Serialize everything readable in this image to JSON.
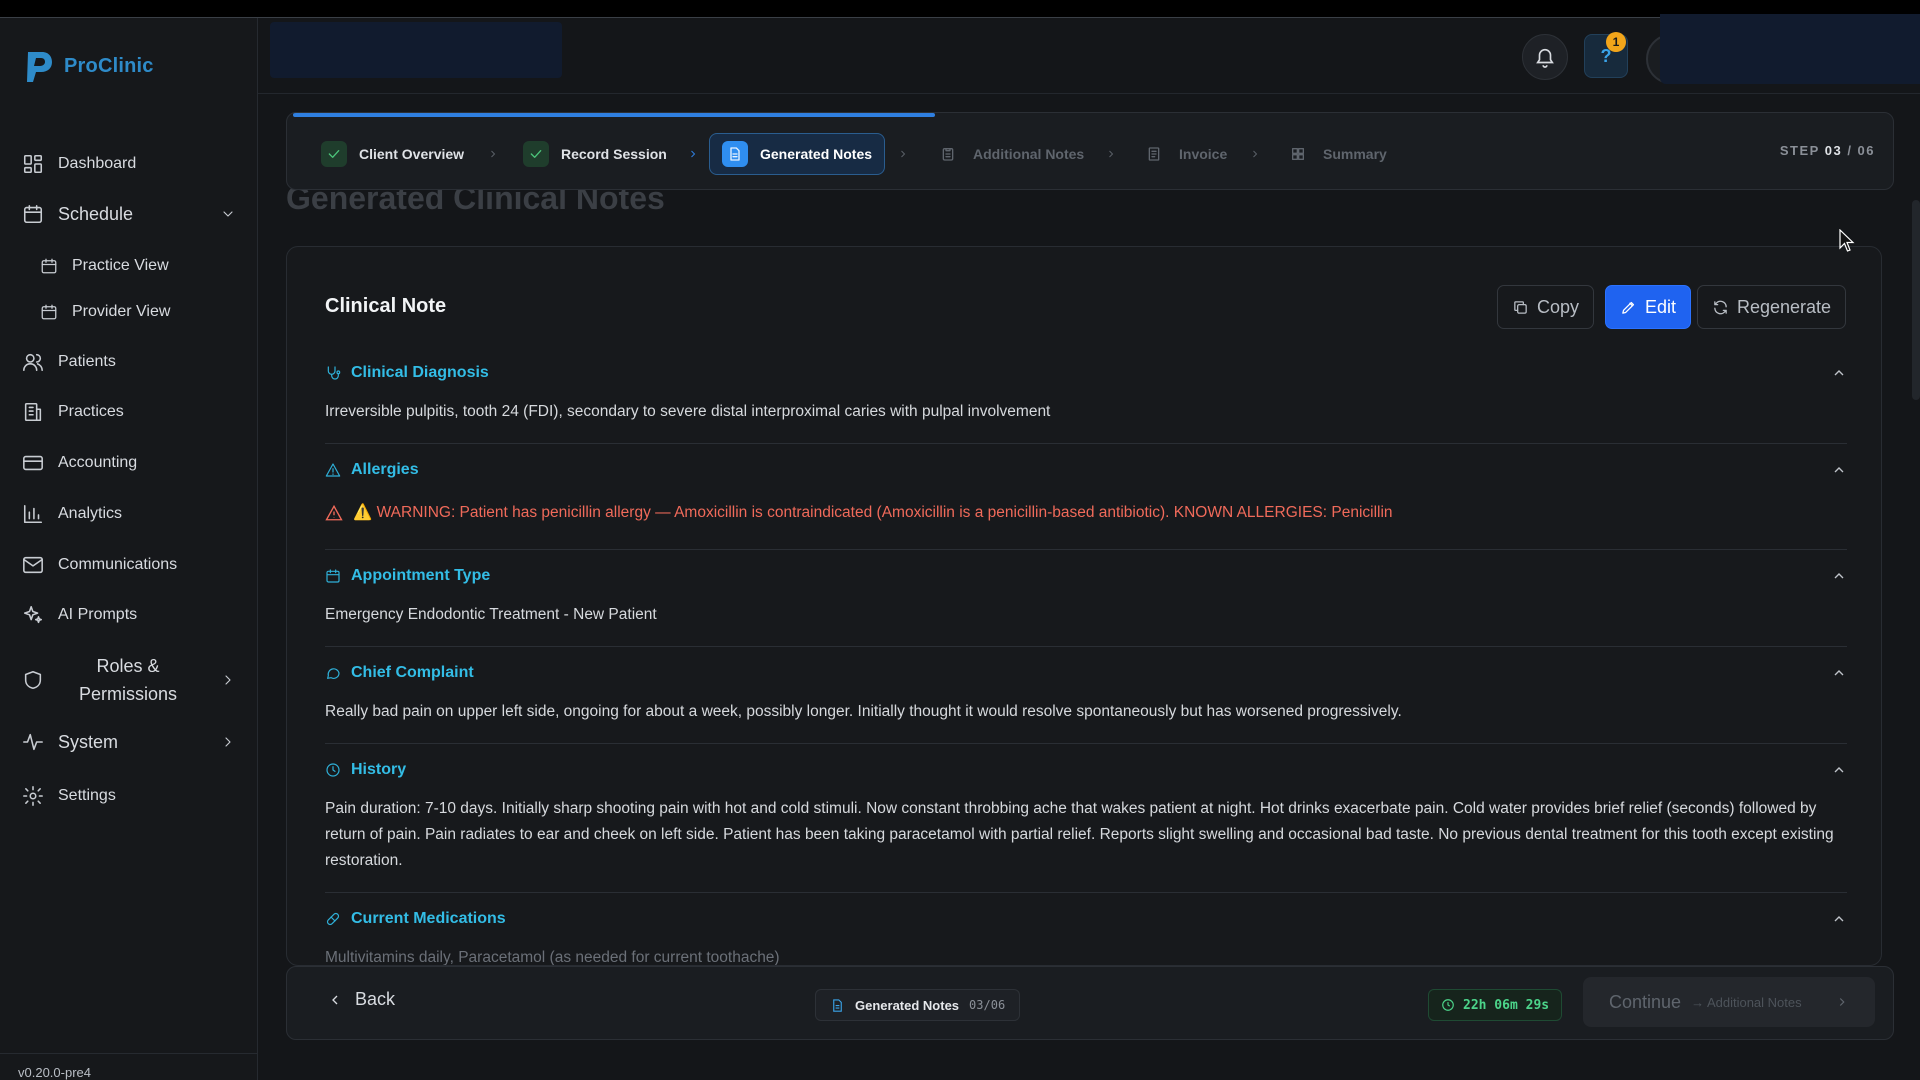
{
  "app": {
    "name": "ProClinic",
    "version": "v0.20.0-pre4"
  },
  "sidebar": {
    "items": [
      {
        "label": "Dashboard",
        "icon": "dashboard-icon"
      },
      {
        "label": "Schedule",
        "icon": "calendar-icon"
      },
      {
        "label": "Practice View",
        "icon": "calendar-icon"
      },
      {
        "label": "Provider View",
        "icon": "calendar-icon"
      },
      {
        "label": "Patients",
        "icon": "users-icon"
      },
      {
        "label": "Practices",
        "icon": "building-icon"
      },
      {
        "label": "Accounting",
        "icon": "card-icon"
      },
      {
        "label": "Analytics",
        "icon": "bar-chart-icon"
      },
      {
        "label": "Communications",
        "icon": "mail-icon"
      },
      {
        "label": "AI Prompts",
        "icon": "sparkle-icon"
      },
      {
        "label": "Roles & Permissions",
        "icon": "shield-icon"
      },
      {
        "label": "System",
        "icon": "activity-icon"
      },
      {
        "label": "Settings",
        "icon": "gear-icon"
      }
    ]
  },
  "header": {
    "notification_count": "1",
    "help_label": "?"
  },
  "stepper": {
    "steps": [
      {
        "label": "Client Overview",
        "state": "done"
      },
      {
        "label": "Record Session",
        "state": "done"
      },
      {
        "label": "Generated Notes",
        "state": "active"
      },
      {
        "label": "Additional Notes",
        "state": "pending"
      },
      {
        "label": "Invoice",
        "state": "pending"
      },
      {
        "label": "Summary",
        "state": "pending"
      }
    ],
    "counter_prefix": "STEP",
    "counter_current": "03",
    "counter_total": "/ 06",
    "progress": 0.4
  },
  "page": {
    "title": "Generated Clinical Notes"
  },
  "note": {
    "title": "Clinical Note",
    "copy_label": "Copy",
    "edit_label": "Edit",
    "regenerate_label": "Regenerate",
    "sections": [
      {
        "title": "Clinical Diagnosis",
        "icon": "stethoscope-icon",
        "body": "Irreversible pulpitis, tooth 24 (FDI), secondary to severe distal interproximal caries with pulpal involvement"
      },
      {
        "title": "Allergies",
        "icon": "warning-icon",
        "body": "⚠️ WARNING: Patient has penicillin allergy — Amoxicillin is contraindicated (Amoxicillin is a penicillin-based antibiotic). KNOWN ALLERGIES: Penicillin"
      },
      {
        "title": "Appointment Type",
        "icon": "calendar-icon",
        "body": "Emergency Endodontic Treatment - New Patient"
      },
      {
        "title": "Chief Complaint",
        "icon": "chat-icon",
        "body": "Really bad pain on upper left side, ongoing for about a week, possibly longer. Initially thought it would resolve spontaneously but has worsened progressively."
      },
      {
        "title": "History",
        "icon": "clock-icon",
        "body": "Pain duration: 7-10 days. Initially sharp shooting pain with hot and cold stimuli. Now constant throbbing ache that wakes patient at night. Hot drinks exacerbate pain. Cold water provides brief relief (seconds) followed by return of pain. Pain radiates to ear and cheek on left side. Patient has been taking paracetamol with partial relief. Reports slight swelling and occasional bad taste. No previous dental treatment for this tooth except existing restoration."
      },
      {
        "title": "Current Medications",
        "icon": "pill-icon",
        "body": "Multivitamins daily, Paracetamol (as needed for current toothache)"
      }
    ]
  },
  "footer": {
    "back_label": "Back",
    "current_step_label": "Generated Notes",
    "current_step_counter": "03/06",
    "timer": "22h 06m 29s",
    "continue_label": "Continue",
    "continue_next": "→ Additional Notes"
  },
  "colors": {
    "accent": "#1f63f0",
    "section_title": "#33bde6",
    "warning": "#f06a5a",
    "success": "#4cc47a",
    "logo": "#2e8bc9"
  }
}
